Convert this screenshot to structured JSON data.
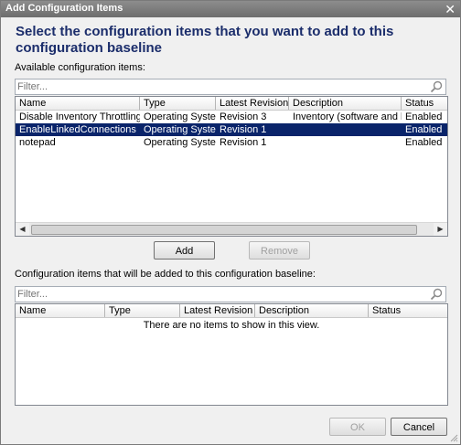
{
  "window": {
    "title": "Add Configuration Items",
    "close_glyph": "✕"
  },
  "heading": "Select the configuration items that you want to add to this configuration baseline",
  "available": {
    "label": "Available configuration items:",
    "filter_placeholder": "Filter...",
    "columns": [
      "Name",
      "Type",
      "Latest Revision",
      "Description",
      "Status"
    ],
    "rows": [
      {
        "name": "Disable Inventory Throttling LPO",
        "type": "Operating System",
        "revision": "Revision 3",
        "description": "Inventory (software and har...",
        "status": "Enabled",
        "selected": false
      },
      {
        "name": "EnableLinkedConnections",
        "type": "Operating System",
        "revision": "Revision 1",
        "description": "",
        "status": "Enabled",
        "selected": true
      },
      {
        "name": "notepad",
        "type": "Operating System",
        "revision": "Revision 1",
        "description": "",
        "status": "Enabled",
        "selected": false
      }
    ]
  },
  "buttons": {
    "add": "Add",
    "remove": "Remove",
    "ok": "OK",
    "cancel": "Cancel"
  },
  "added": {
    "label": "Configuration items that will be added to this configuration baseline:",
    "filter_placeholder": "Filter...",
    "columns": [
      "Name",
      "Type",
      "Latest Revision",
      "Description",
      "Status"
    ],
    "empty_message": "There are no items to show in this view."
  },
  "colors": {
    "heading": "#1b2d6b",
    "selection": "#0a246a",
    "titlebar": "#7a7a7a"
  },
  "icons": {
    "filter": "magnifier-icon",
    "close": "close-icon"
  }
}
